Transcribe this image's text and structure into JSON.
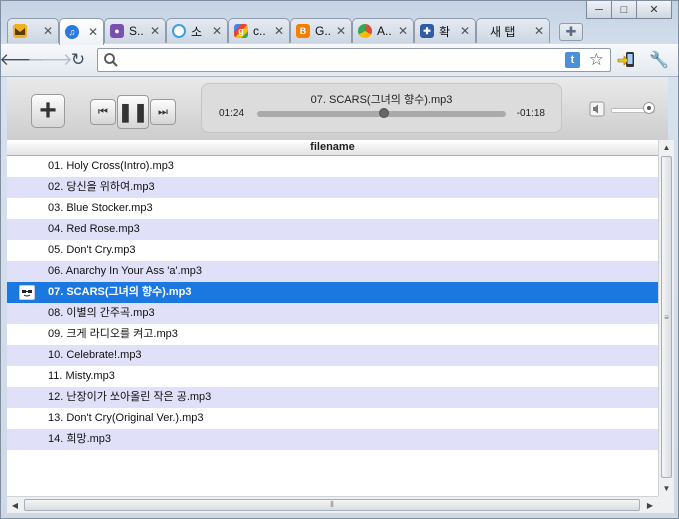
{
  "window": {
    "minimize": "─",
    "maximize": "□",
    "close": "✕"
  },
  "tabs": [
    {
      "title": "",
      "icon": "mail-bird-icon",
      "color": "#f0b020"
    },
    {
      "title": "",
      "icon": "itunes-note-icon",
      "color": "#2a7ae0"
    },
    {
      "title": "S..",
      "icon": "chat-bubble-icon",
      "color": "#7a4fb0"
    },
    {
      "title": "소",
      "icon": "circle-logo-icon",
      "color": "#3aa0e0"
    },
    {
      "title": "c..",
      "icon": "google-icon",
      "color": "#4285f4"
    },
    {
      "title": "G..",
      "icon": "blogger-icon",
      "color": "#f57d00"
    },
    {
      "title": "A..",
      "icon": "chrome-icon",
      "color": "#dd4b39"
    },
    {
      "title": "확",
      "icon": "puzzle-extension-icon",
      "color": "#2d5da8"
    },
    {
      "title": "새 탭",
      "icon": "",
      "color": ""
    }
  ],
  "toolbar": {
    "url": "",
    "t_label": "t"
  },
  "player": {
    "now_playing": "07. SCARS(그녀의 향수).mp3",
    "elapsed": "01:24",
    "remaining": "-01:18",
    "progress": 0.51,
    "volume": 0.85
  },
  "list": {
    "column": "filename",
    "selected": 6,
    "items": [
      "01. Holy Cross(Intro).mp3",
      "02. 당신을 위하여.mp3",
      "03. Blue Stocker.mp3",
      "04. Red Rose.mp3",
      "05. Don't Cry.mp3",
      "06. Anarchy In Your Ass 'a'.mp3",
      "07. SCARS(그녀의 향수).mp3",
      "08. 이별의 간주곡.mp3",
      "09. 크게 라디오를 켜고.mp3",
      "10. Celebrate!.mp3",
      "11. Misty.mp3",
      "12. 난장이가 쏘아올린 작은 공.mp3",
      "13. Don't Cry(Original Ver.).mp3",
      "14. 희망.mp3"
    ]
  },
  "colors": {
    "selected_row": "#1a78e0",
    "alt_row": "#e0e0f8"
  }
}
